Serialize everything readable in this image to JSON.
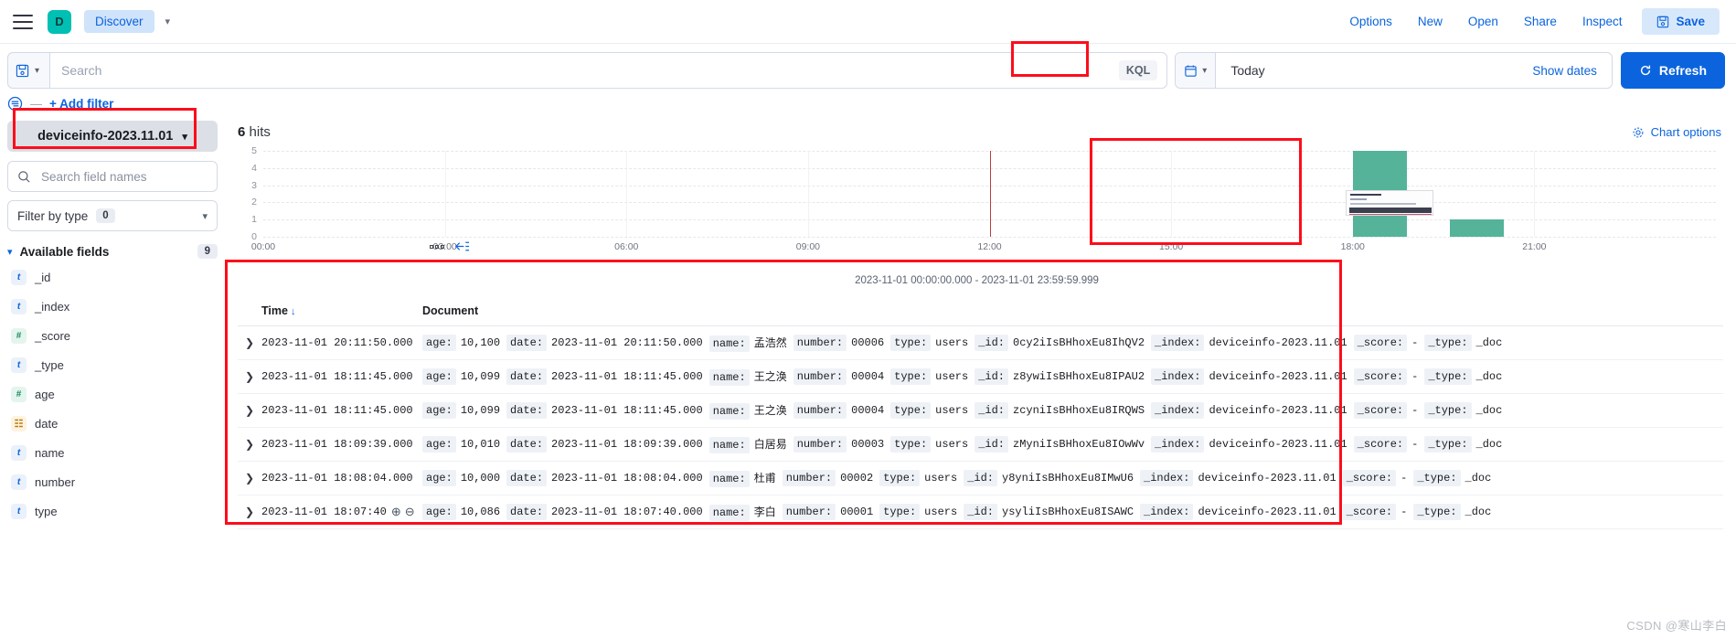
{
  "topnav": {
    "menu_icon": "hamburger-icon",
    "app_badge": "D",
    "breadcrumb": "Discover",
    "links": [
      "Options",
      "New",
      "Open",
      "Share",
      "Inspect"
    ],
    "save_label": "Save"
  },
  "querybar": {
    "search_placeholder": "Search",
    "search_value": "",
    "kql_label": "KQL",
    "date_value": "Today",
    "show_dates_label": "Show dates",
    "refresh_label": "Refresh"
  },
  "filterbar": {
    "dash": "—",
    "add_filter_label": "+ Add filter"
  },
  "sidebar": {
    "index_pattern": "deviceinfo-2023.11.01",
    "field_search_placeholder": "Search field names",
    "filter_by_type_label": "Filter by type",
    "filter_by_type_count": "0",
    "available_fields_label": "Available fields",
    "available_fields_count": "9",
    "fields": [
      {
        "name": "_id",
        "type": "t"
      },
      {
        "name": "_index",
        "type": "t"
      },
      {
        "name": "_score",
        "type": "n"
      },
      {
        "name": "_type",
        "type": "t"
      },
      {
        "name": "age",
        "type": "n"
      },
      {
        "name": "date",
        "type": "d"
      },
      {
        "name": "name",
        "type": "t"
      },
      {
        "name": "number",
        "type": "t"
      },
      {
        "name": "type",
        "type": "t"
      }
    ]
  },
  "main": {
    "hits_count": "6",
    "hits_label": "hits",
    "chart_options_label": "Chart options"
  },
  "chart_data": {
    "type": "bar",
    "title": "",
    "subtitle": "2023-11-01 00:00:00.000 - 2023-11-01 23:59:59.999",
    "xlabel": "",
    "ylabel": "",
    "ylim": [
      0,
      5
    ],
    "yticks": [
      0,
      1,
      2,
      3,
      4,
      5
    ],
    "xticks": [
      "00:00",
      "03:00",
      "06:00",
      "09:00",
      "12:00",
      "15:00",
      "18:00",
      "21:00"
    ],
    "x_range_hours": [
      0,
      24
    ],
    "grid": true,
    "legend": "none",
    "bar_color": "#54b399",
    "now_marker_hour": 12.0,
    "now_marker_color": "#bd3c3c",
    "categories": [
      "18:00",
      "19:30"
    ],
    "values": [
      5,
      1
    ],
    "bars": [
      {
        "hour": 18.0,
        "width_hours": 0.9,
        "value": 5
      },
      {
        "hour": 19.6,
        "width_hours": 0.9,
        "value": 1
      }
    ]
  },
  "table": {
    "headers": {
      "time": "Time",
      "document": "Document",
      "sort_arrow": "↓"
    },
    "rows": [
      {
        "time": "2023-11-01 20:11:50.000",
        "fields": [
          {
            "k": "age:",
            "v": "10,100"
          },
          {
            "k": "date:",
            "v": "2023-11-01 20:11:50.000"
          },
          {
            "k": "name:",
            "v": "孟浩然"
          },
          {
            "k": "number:",
            "v": "00006"
          },
          {
            "k": "type:",
            "v": "users"
          },
          {
            "k": "_id:",
            "v": "0cy2iIsBHhoxEu8IhQV2"
          },
          {
            "k": "_index:",
            "v": "deviceinfo-2023.11.01"
          },
          {
            "k": "_score:",
            "v": "-"
          },
          {
            "k": "_type:",
            "v": "_doc"
          }
        ]
      },
      {
        "time": "2023-11-01 18:11:45.000",
        "fields": [
          {
            "k": "age:",
            "v": "10,099"
          },
          {
            "k": "date:",
            "v": "2023-11-01 18:11:45.000"
          },
          {
            "k": "name:",
            "v": "王之涣"
          },
          {
            "k": "number:",
            "v": "00004"
          },
          {
            "k": "type:",
            "v": "users"
          },
          {
            "k": "_id:",
            "v": "z8ywiIsBHhoxEu8IPAU2"
          },
          {
            "k": "_index:",
            "v": "deviceinfo-2023.11.01"
          },
          {
            "k": "_score:",
            "v": "-"
          },
          {
            "k": "_type:",
            "v": "_doc"
          }
        ]
      },
      {
        "time": "2023-11-01 18:11:45.000",
        "fields": [
          {
            "k": "age:",
            "v": "10,099"
          },
          {
            "k": "date:",
            "v": "2023-11-01 18:11:45.000"
          },
          {
            "k": "name:",
            "v": "王之涣"
          },
          {
            "k": "number:",
            "v": "00004"
          },
          {
            "k": "type:",
            "v": "users"
          },
          {
            "k": "_id:",
            "v": "zcyniIsBHhoxEu8IRQWS"
          },
          {
            "k": "_index:",
            "v": "deviceinfo-2023.11.01"
          },
          {
            "k": "_score:",
            "v": "-"
          },
          {
            "k": "_type:",
            "v": "_doc"
          }
        ]
      },
      {
        "time": "2023-11-01 18:09:39.000",
        "fields": [
          {
            "k": "age:",
            "v": "10,010"
          },
          {
            "k": "date:",
            "v": "2023-11-01 18:09:39.000"
          },
          {
            "k": "name:",
            "v": "白居易"
          },
          {
            "k": "number:",
            "v": "00003"
          },
          {
            "k": "type:",
            "v": "users"
          },
          {
            "k": "_id:",
            "v": "zMyniIsBHhoxEu8IOwWv"
          },
          {
            "k": "_index:",
            "v": "deviceinfo-2023.11.01"
          },
          {
            "k": "_score:",
            "v": "-"
          },
          {
            "k": "_type:",
            "v": "_doc"
          }
        ]
      },
      {
        "time": "2023-11-01 18:08:04.000",
        "fields": [
          {
            "k": "age:",
            "v": "10,000"
          },
          {
            "k": "date:",
            "v": "2023-11-01 18:08:04.000"
          },
          {
            "k": "name:",
            "v": "杜甫"
          },
          {
            "k": "number:",
            "v": "00002"
          },
          {
            "k": "type:",
            "v": "users"
          },
          {
            "k": "_id:",
            "v": "y8yniIsBHhoxEu8IMwU6"
          },
          {
            "k": "_index:",
            "v": "deviceinfo-2023.11.01"
          },
          {
            "k": "_score:",
            "v": "-"
          },
          {
            "k": "_type:",
            "v": "_doc"
          }
        ]
      },
      {
        "time": "2023-11-01 18:07:40",
        "fields": [
          {
            "k": "age:",
            "v": "10,086"
          },
          {
            "k": "date:",
            "v": "2023-11-01 18:07:40.000"
          },
          {
            "k": "name:",
            "v": "李白"
          },
          {
            "k": "number:",
            "v": "00001"
          },
          {
            "k": "type:",
            "v": "users"
          },
          {
            "k": "_id:",
            "v": "ysyliIsBHhoxEu8ISAWC"
          },
          {
            "k": "_index:",
            "v": "deviceinfo-2023.11.01"
          },
          {
            "k": "_score:",
            "v": "-"
          },
          {
            "k": "_type:",
            "v": "_doc"
          }
        ]
      }
    ]
  },
  "watermark": "CSDN @寒山李白",
  "colors": {
    "accent_blue": "#0b64dd",
    "bar_green": "#54b399",
    "annotation_red": "#fc0d1b",
    "badge_teal": "#00bfb3"
  }
}
